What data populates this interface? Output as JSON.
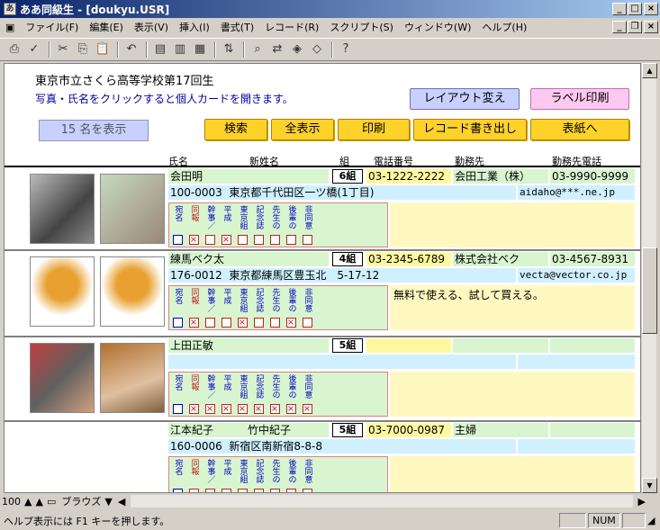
{
  "window": {
    "title": "ああ同級生 - [doukyu.USR]"
  },
  "menu": [
    "ファイル(F)",
    "編集(E)",
    "表示(V)",
    "挿入(I)",
    "書式(T)",
    "レコード(R)",
    "スクリプト(S)",
    "ウィンドウ(W)",
    "ヘルプ(H)"
  ],
  "header": {
    "school": "東京市立さくら高等学校第17回生",
    "hint": "写真・氏名をクリックすると個人カードを開きます。",
    "count_display": "15 名を表示",
    "layout_button": "レイアウト変え",
    "label_button": "ラベル印刷",
    "search_button": "検索",
    "showall_button": "全表示",
    "print_button": "印刷",
    "export_button": "レコード書き出し",
    "cover_button": "表紙へ"
  },
  "columns": {
    "name": "氏名",
    "newname": "新姓名",
    "group": "組",
    "phone": "電話番号",
    "work": "勤務先",
    "workphone": "勤務先電話"
  },
  "check_labels": [
    "宛名",
    "同報",
    "幹事／",
    "平成",
    "東京組",
    "記念誌",
    "先生の",
    "後輩の",
    "非同意"
  ],
  "records": [
    {
      "name": "会田明",
      "newname": "",
      "group": "6組",
      "phone": "03-1222-2222",
      "work": "会田工業（株）",
      "workphone": "03-9990-9999",
      "zip": "100-0003",
      "address": "東京都千代田区一ツ橋(1丁目)",
      "email": "aidaho@***.ne.jp",
      "checks": [
        0,
        1,
        0,
        1,
        0,
        0,
        0,
        0,
        0
      ],
      "memo": ""
    },
    {
      "name": "練馬ベク太",
      "newname": "",
      "group": "4組",
      "phone": "03-2345-6789",
      "work": "株式会社ベク",
      "workphone": "03-4567-8931",
      "zip": "176-0012",
      "address": "東京都練馬区豊玉北　5-17-12",
      "email": "vecta@vector.co.jp",
      "checks": [
        0,
        1,
        0,
        0,
        1,
        0,
        0,
        1,
        0
      ],
      "memo": "無料で使える、試して買える。"
    },
    {
      "name": "上田正敏",
      "newname": "",
      "group": "5組",
      "phone": "",
      "work": "",
      "workphone": "",
      "zip": "",
      "address": "",
      "email": "",
      "checks": [
        0,
        1,
        1,
        1,
        1,
        1,
        1,
        1,
        1
      ],
      "memo": ""
    },
    {
      "name": "江本紀子",
      "newname": "竹中紀子",
      "group": "5組",
      "phone": "03-7000-0987",
      "work": "主婦",
      "workphone": "",
      "zip": "160-0006",
      "address": "新宿区南新宿8-8-8",
      "email": "",
      "checks": [
        0,
        0,
        0,
        0,
        0,
        0,
        0,
        0,
        0
      ],
      "memo": ""
    }
  ],
  "hbar": {
    "zoom": "100",
    "mode": "ブラウズ"
  },
  "status": {
    "help": "ヘルプ表示には F1 キーを押します。",
    "num": "NUM"
  }
}
